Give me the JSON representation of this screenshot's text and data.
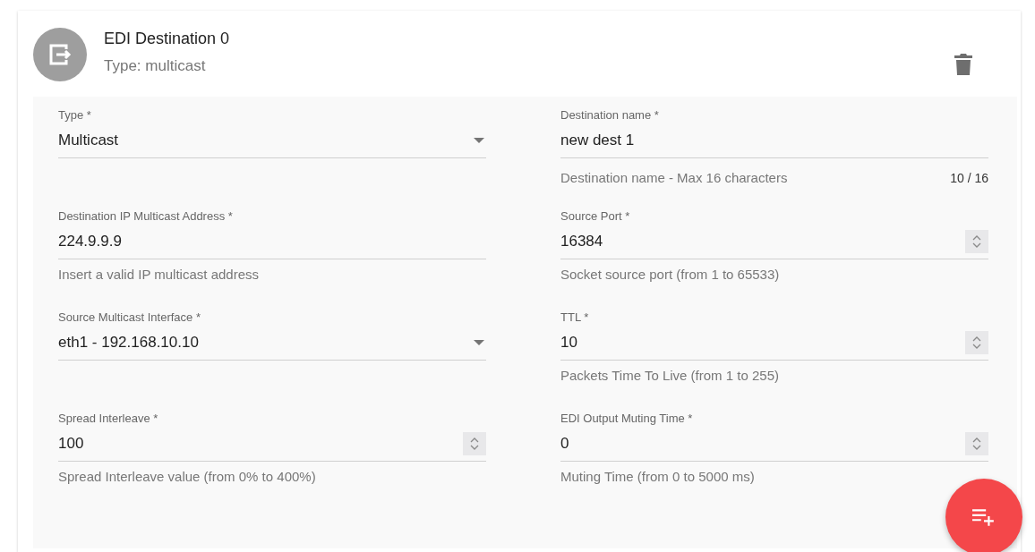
{
  "header": {
    "title": "EDI Destination 0",
    "subtitle": "Type: multicast"
  },
  "fields": [
    {
      "kind": "select",
      "label": "Type *",
      "value": "Multicast"
    },
    {
      "kind": "text",
      "label": "Destination name *",
      "value": "new dest 1",
      "hint": "Destination name - Max 16 characters",
      "counter": "10 / 16"
    },
    {
      "kind": "text",
      "label": "Destination IP Multicast Address *",
      "value": "224.9.9.9",
      "hint": "Insert a valid IP multicast address"
    },
    {
      "kind": "number",
      "label": "Source Port *",
      "value": "16384",
      "hint": "Socket source port (from 1 to 65533)"
    },
    {
      "kind": "select",
      "label": "Source Multicast Interface *",
      "value": "eth1 - 192.168.10.10"
    },
    {
      "kind": "number",
      "label": "TTL *",
      "value": "10",
      "hint": "Packets Time To Live (from 1 to 255)"
    },
    {
      "kind": "number",
      "label": "Spread Interleave *",
      "value": "100",
      "hint": "Spread Interleave value (from 0% to 400%)"
    },
    {
      "kind": "number",
      "label": "EDI Output Muting Time *",
      "value": "0",
      "hint": "Muting Time (from 0 to 5000 ms)"
    }
  ]
}
